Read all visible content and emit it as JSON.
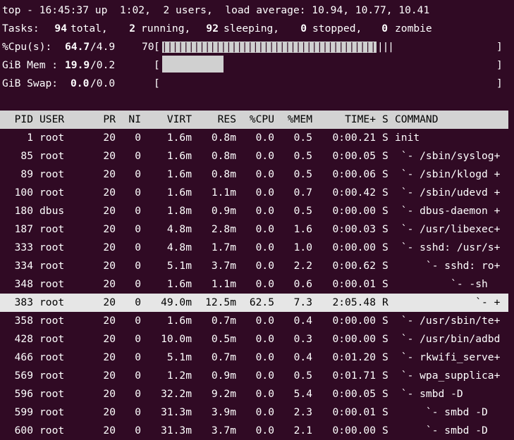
{
  "summary": {
    "line1": "top - 16:45:37 up  1:02,  2 users,  load average: 10.94, 10.77, 10.41",
    "tasks": {
      "label": "Tasks:",
      "total": "94",
      "total_label": "total,",
      "running": "2",
      "running_label": "running,",
      "sleeping": "92",
      "sleeping_label": "sleeping,",
      "stopped": "0",
      "stopped_label": "stopped,",
      "zombie": "0",
      "zombie_label": "zombie"
    },
    "cpu": {
      "label": "%Cpu(s):",
      "value": "64.7",
      "rest": "/4.9",
      "scale": "70",
      "bar_open": "[",
      "bar_ticks": "||||||||||||||||||||||||||||||||||||||||",
      "bar_tail": "|||",
      "bar_close": "]",
      "usage_fraction": 0.7
    },
    "mem": {
      "label": "GiB Mem :",
      "value": "19.9",
      "rest": "/0.2",
      "bar_open": "[",
      "bar_close": "]",
      "usage_fraction": 0.18
    },
    "swap": {
      "label": "GiB Swap:",
      "value": "0.0",
      "rest": "/0.0",
      "bar_open": "[",
      "bar_close": "]",
      "usage_fraction": 0.0
    }
  },
  "table": {
    "headers": {
      "pid": "PID",
      "user": "USER",
      "pr": "PR",
      "ni": "NI",
      "virt": "VIRT",
      "res": "RES",
      "cpu": "%CPU",
      "mem": "%MEM",
      "time": "TIME+",
      "s": "S",
      "command": "COMMAND"
    },
    "rows": [
      {
        "pid": "1",
        "user": "root",
        "pr": "20",
        "ni": "0",
        "virt": "1.6m",
        "res": "0.8m",
        "cpu": "0.0",
        "mem": "0.5",
        "time": "0:00.21",
        "s": "S",
        "command": "init"
      },
      {
        "pid": "85",
        "user": "root",
        "pr": "20",
        "ni": "0",
        "virt": "1.6m",
        "res": "0.8m",
        "cpu": "0.0",
        "mem": "0.5",
        "time": "0:00.05",
        "s": "S",
        "command": " `- /sbin/syslog+"
      },
      {
        "pid": "89",
        "user": "root",
        "pr": "20",
        "ni": "0",
        "virt": "1.6m",
        "res": "0.8m",
        "cpu": "0.0",
        "mem": "0.5",
        "time": "0:00.06",
        "s": "S",
        "command": " `- /sbin/klogd +"
      },
      {
        "pid": "100",
        "user": "root",
        "pr": "20",
        "ni": "0",
        "virt": "1.6m",
        "res": "1.1m",
        "cpu": "0.0",
        "mem": "0.7",
        "time": "0:00.42",
        "s": "S",
        "command": " `- /sbin/udevd +"
      },
      {
        "pid": "180",
        "user": "dbus",
        "pr": "20",
        "ni": "0",
        "virt": "1.8m",
        "res": "0.9m",
        "cpu": "0.0",
        "mem": "0.5",
        "time": "0:00.00",
        "s": "S",
        "command": " `- dbus-daemon +"
      },
      {
        "pid": "187",
        "user": "root",
        "pr": "20",
        "ni": "0",
        "virt": "4.8m",
        "res": "2.8m",
        "cpu": "0.0",
        "mem": "1.6",
        "time": "0:00.03",
        "s": "S",
        "command": " `- /usr/libexec+"
      },
      {
        "pid": "333",
        "user": "root",
        "pr": "20",
        "ni": "0",
        "virt": "4.8m",
        "res": "1.7m",
        "cpu": "0.0",
        "mem": "1.0",
        "time": "0:00.00",
        "s": "S",
        "command": " `- sshd: /usr/s+"
      },
      {
        "pid": "334",
        "user": "root",
        "pr": "20",
        "ni": "0",
        "virt": "5.1m",
        "res": "3.7m",
        "cpu": "0.0",
        "mem": "2.2",
        "time": "0:00.62",
        "s": "S",
        "command": "     `- sshd: ro+"
      },
      {
        "pid": "348",
        "user": "root",
        "pr": "20",
        "ni": "0",
        "virt": "1.6m",
        "res": "1.1m",
        "cpu": "0.0",
        "mem": "0.6",
        "time": "0:00.01",
        "s": "S",
        "command": "         `- -sh"
      },
      {
        "pid": "383",
        "user": "root",
        "pr": "20",
        "ni": "0",
        "virt": "49.0m",
        "res": "12.5m",
        "cpu": "62.5",
        "mem": "7.3",
        "time": "2:05.48",
        "s": "R",
        "command": "             `- +"
      },
      {
        "pid": "358",
        "user": "root",
        "pr": "20",
        "ni": "0",
        "virt": "1.6m",
        "res": "0.7m",
        "cpu": "0.0",
        "mem": "0.4",
        "time": "0:00.00",
        "s": "S",
        "command": " `- /usr/sbin/te+"
      },
      {
        "pid": "428",
        "user": "root",
        "pr": "20",
        "ni": "0",
        "virt": "10.0m",
        "res": "0.5m",
        "cpu": "0.0",
        "mem": "0.3",
        "time": "0:00.00",
        "s": "S",
        "command": " `- /usr/bin/adbd"
      },
      {
        "pid": "466",
        "user": "root",
        "pr": "20",
        "ni": "0",
        "virt": "5.1m",
        "res": "0.7m",
        "cpu": "0.0",
        "mem": "0.4",
        "time": "0:01.20",
        "s": "S",
        "command": " `- rkwifi_serve+"
      },
      {
        "pid": "569",
        "user": "root",
        "pr": "20",
        "ni": "0",
        "virt": "1.2m",
        "res": "0.9m",
        "cpu": "0.0",
        "mem": "0.5",
        "time": "0:01.71",
        "s": "S",
        "command": " `- wpa_supplica+"
      },
      {
        "pid": "596",
        "user": "root",
        "pr": "20",
        "ni": "0",
        "virt": "32.2m",
        "res": "9.2m",
        "cpu": "0.0",
        "mem": "5.4",
        "time": "0:00.05",
        "s": "S",
        "command": " `- smbd -D"
      },
      {
        "pid": "599",
        "user": "root",
        "pr": "20",
        "ni": "0",
        "virt": "31.3m",
        "res": "3.9m",
        "cpu": "0.0",
        "mem": "2.3",
        "time": "0:00.01",
        "s": "S",
        "command": "     `- smbd -D"
      },
      {
        "pid": "600",
        "user": "root",
        "pr": "20",
        "ni": "0",
        "virt": "31.3m",
        "res": "3.7m",
        "cpu": "0.0",
        "mem": "2.1",
        "time": "0:00.00",
        "s": "S",
        "command": "     `- smbd -D"
      }
    ],
    "selected_pid": "383"
  },
  "colors": {
    "terminal_background": "#300a24",
    "text": "#ffffff",
    "header_row_background": "#d3d3d3",
    "selected_row_background": "#e6e6e6",
    "meter_fill": "#d0d0d0"
  }
}
